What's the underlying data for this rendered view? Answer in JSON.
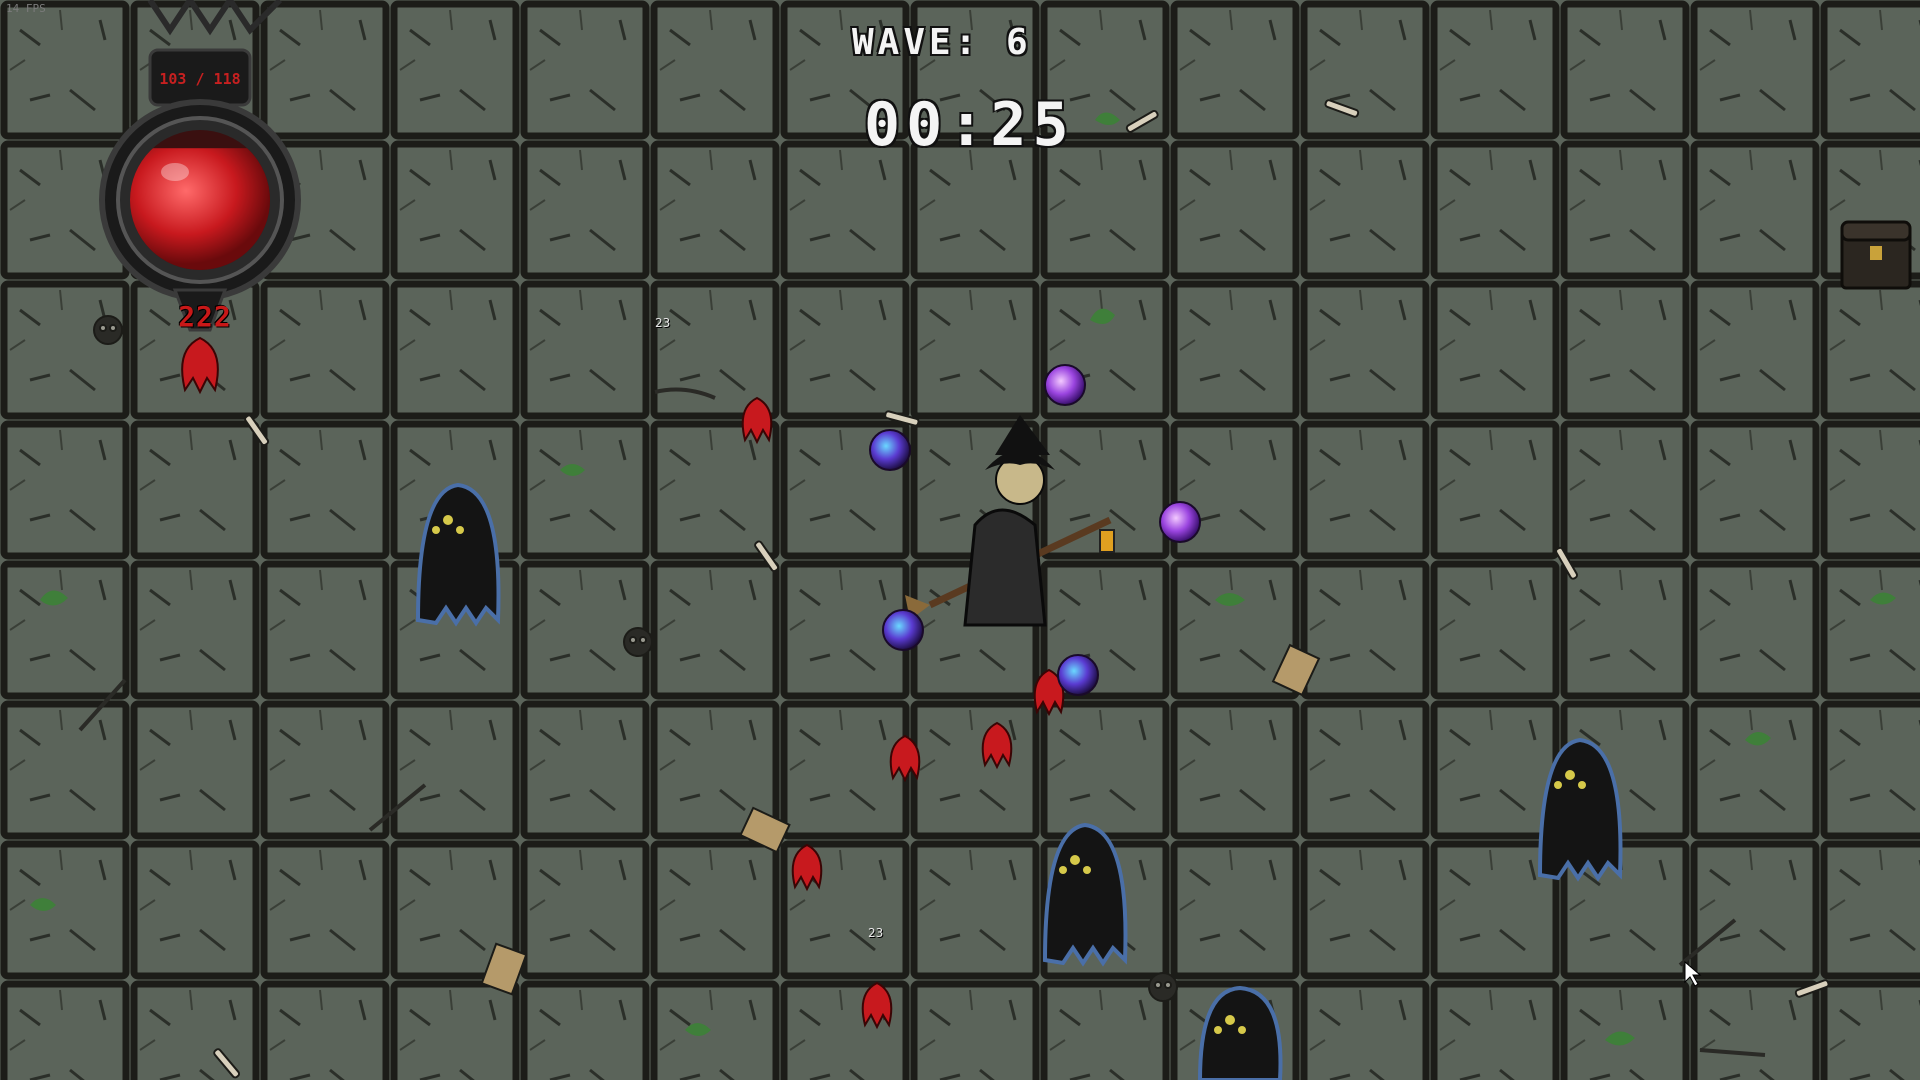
{
  "hud": {
    "fps": "14 FPS",
    "wave_label": "WAVE: 6",
    "timer": "00:25",
    "health_text": "103 / 118",
    "health_fraction": 0.87,
    "level": "222"
  },
  "damage_numbers": [
    "23",
    "23"
  ],
  "colors": {
    "floor": "#5b645a",
    "tile_line": "#1c1c18",
    "health": "#c8191e",
    "orb": "#8a3bd1",
    "ghost": "#141414"
  },
  "icons": [
    "health-orb-icon",
    "treasure-chest-icon",
    "witch-player-icon",
    "ghost-enemy-icon",
    "red-imp-enemy-icon",
    "magic-orb-icon",
    "mouse-cursor-icon"
  ]
}
